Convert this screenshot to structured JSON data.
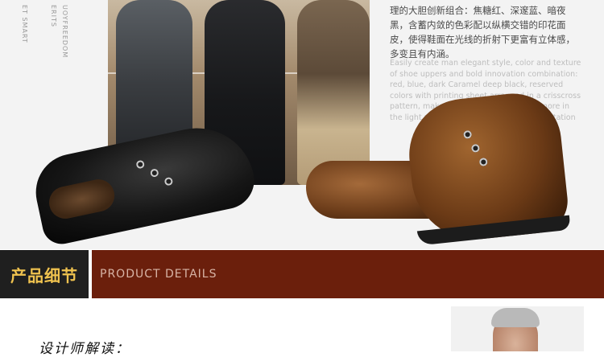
{
  "vertical_texts": [
    "ET SMART",
    "ERITS",
    "UOYFREEDOM"
  ],
  "description": {
    "zh": "理的大胆创新组合：焦糖红、深邃蓝、暗夜黑，含蓄内敛的色彩配以纵横交错的印花面皮，使得鞋面在光线的折射下更富有立体感，多变且有内涵。",
    "en": "Easily create man elegant style, color and texture of shoe uppers and bold innovation combination: red, blue, dark Caramel deep black, reserved colors with printing sheet arranged in a crisscross pattern, make the vamp stereo feeling more in the light refraction, changeable and connotation"
  },
  "section": {
    "title_zh": "产品细节",
    "title_en": "PRODUCT DETAILS"
  },
  "designer_label": "设计师解读：",
  "colors": {
    "bar_dark": "#1f1f1f",
    "bar_brown": "#6b1f0c",
    "title_gold": "#f0c34f"
  }
}
